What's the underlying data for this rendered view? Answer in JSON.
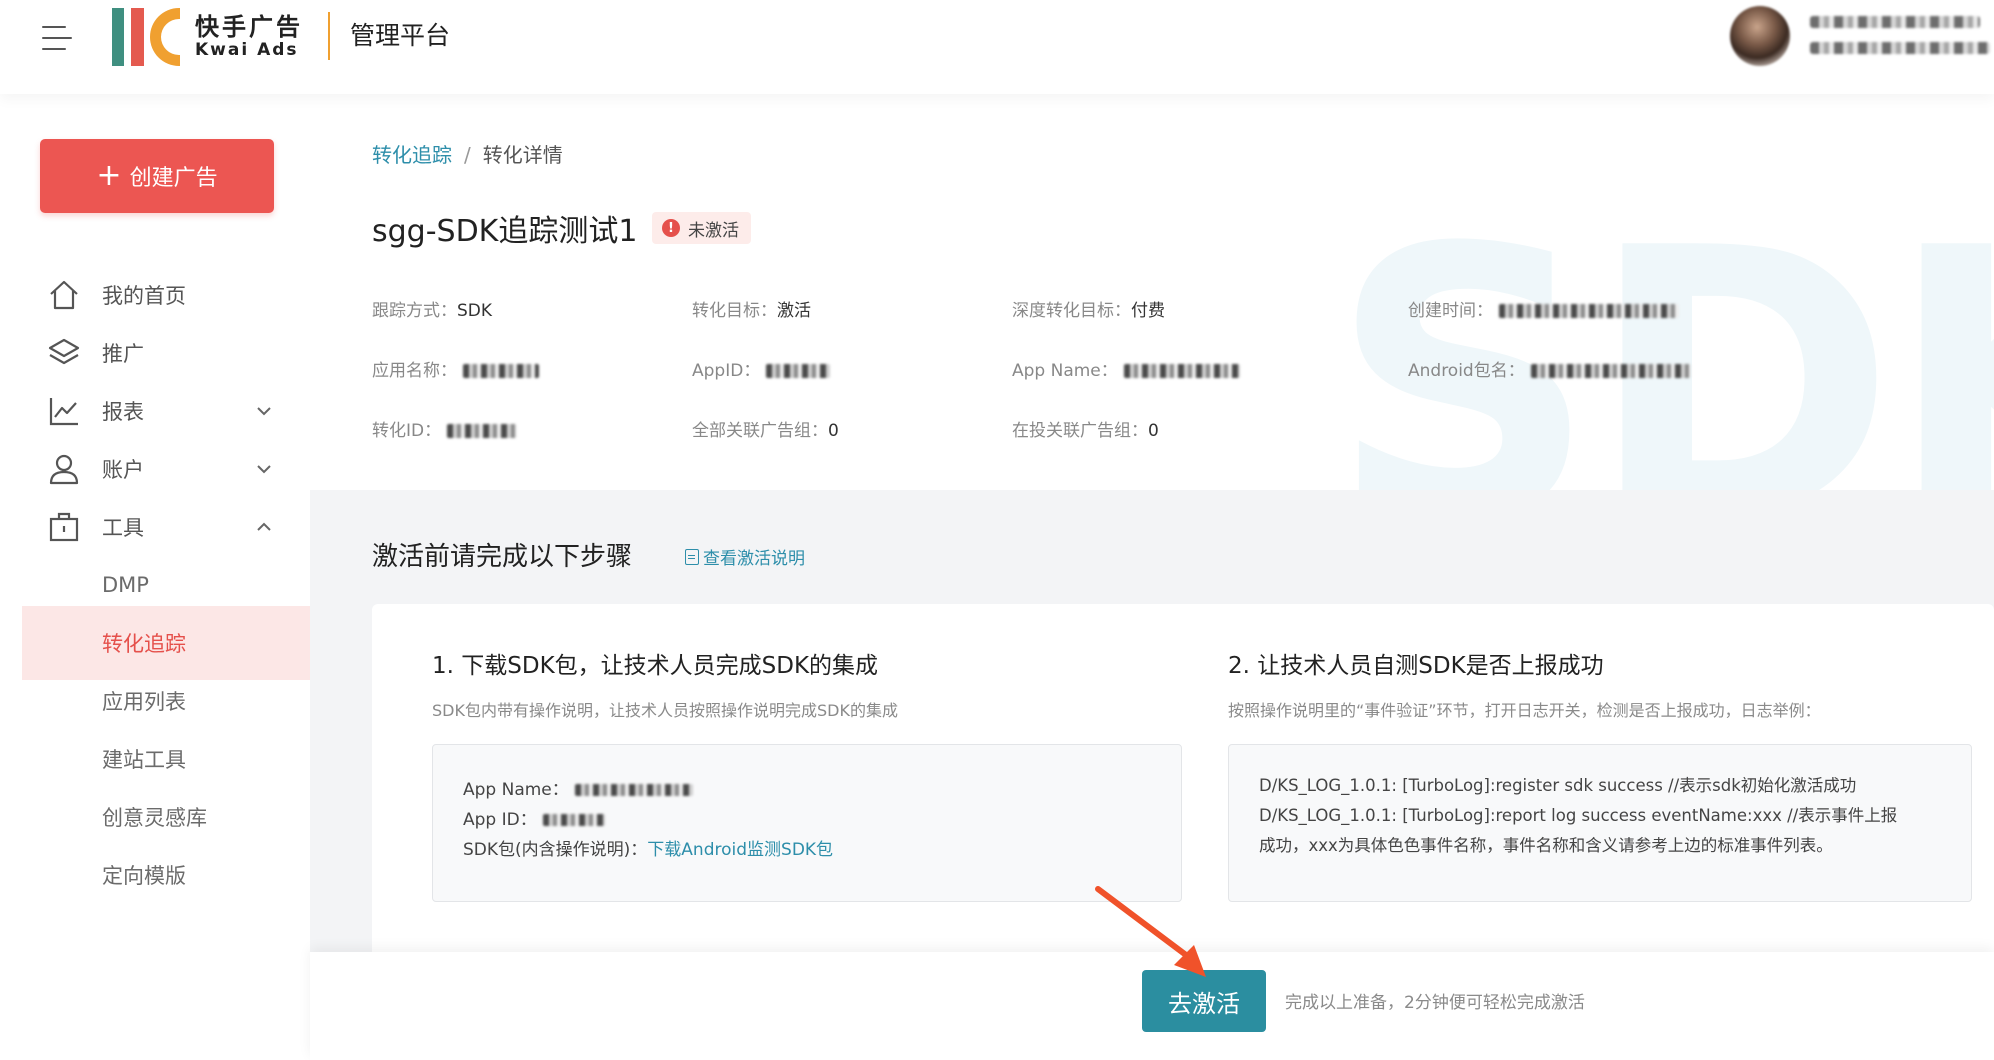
{
  "header": {
    "logo_cn": "快手广告",
    "logo_en": "Kwai Ads",
    "platform": "管理平台"
  },
  "sidebar": {
    "create_button": "创建广告",
    "items": [
      {
        "label": "我的首页",
        "icon": "home-icon"
      },
      {
        "label": "推广",
        "icon": "layers-icon"
      },
      {
        "label": "报表",
        "icon": "chart-line-icon",
        "chevron": "down"
      },
      {
        "label": "账户",
        "icon": "user-icon",
        "chevron": "down"
      },
      {
        "label": "工具",
        "icon": "toolbox-icon",
        "chevron": "up"
      }
    ],
    "sub_items": [
      {
        "label": "DMP",
        "active": false
      },
      {
        "label": "转化追踪",
        "active": true
      },
      {
        "label": "应用列表",
        "active": false
      },
      {
        "label": "建站工具",
        "active": false
      },
      {
        "label": "创意灵感库",
        "active": false
      },
      {
        "label": "定向模版",
        "active": false
      }
    ]
  },
  "breadcrumb": {
    "parent": "转化追踪",
    "separator": "/",
    "current": "转化详情"
  },
  "detail": {
    "title": "sgg-SDK追踪测试1",
    "status": "未激活",
    "watermark": "SDK",
    "fields": {
      "tracking_key": "跟踪方式：",
      "tracking_val": "SDK",
      "goal_key": "转化目标：",
      "goal_val": "激活",
      "deep_goal_key": "深度转化目标：",
      "deep_goal_val": "付费",
      "created_key": "创建时间：",
      "app_name_key": "应用名称：",
      "appid_key": "AppID：",
      "app_name_en_key": "App Name：",
      "android_pkg_key": "Android包名：",
      "conv_id_key": "转化ID：",
      "all_groups_key": "全部关联广告组：",
      "all_groups_val": "0",
      "active_groups_key": "在投关联广告组：",
      "active_groups_val": "0"
    }
  },
  "steps": {
    "title": "激活前请完成以下步骤",
    "help_link": "查看激活说明",
    "step1": {
      "title": "1. 下载SDK包，让技术人员完成SDK的集成",
      "desc": "SDK包内带有操作说明，让技术人员按照操作说明完成SDK的集成",
      "app_name_label": "App Name：",
      "app_id_label": "App ID：",
      "sdk_label": "SDK包(内含操作说明)：",
      "sdk_link": "下载Android监测SDK包"
    },
    "step2": {
      "title": "2. 让技术人员自测SDK是否上报成功",
      "desc": "按照操作说明里的“事件验证”环节，打开日志开关，检测是否上报成功，日志举例：",
      "log_line1": "D/KS_LOG_1.0.1: [TurboLog]:register sdk success //表示sdk初始化激活成功",
      "log_line2": "D/KS_LOG_1.0.1: [TurboLog]:report log success eventName:xxx //表示事件上报",
      "log_line3": "成功，xxx为具体色色事件名称，事件名称和含义请参考上边的标准事件列表。"
    }
  },
  "footer": {
    "activate_button": "去激活",
    "hint": "完成以上准备，2分钟便可轻松完成激活"
  },
  "colors": {
    "brand_red": "#ec5652",
    "link_teal": "#2d8eaa",
    "activate_teal": "#2b8ea0",
    "arrow_orange": "#f0522a"
  }
}
